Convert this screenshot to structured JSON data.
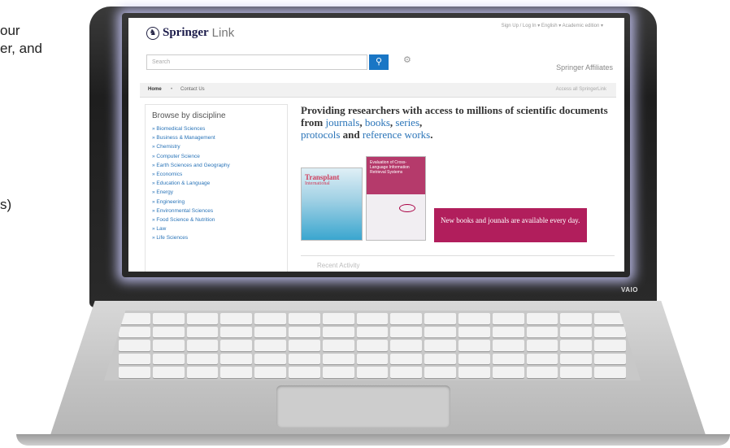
{
  "slide": {
    "lines": [
      "our",
      "er, and",
      "s)"
    ]
  },
  "device": {
    "brand": "VAIO"
  },
  "site": {
    "logo_primary": "Springer",
    "logo_secondary": "Link",
    "logo_icon": "springer-horse-icon",
    "top_nav": "Sign Up / Log In  ▾  English ▾  Academic edition ▾",
    "search_placeholder": "Search",
    "search_button_icon": "search-icon",
    "settings_icon": "gear-icon",
    "affiliates": "Springer Affiliates",
    "breadcrumb": {
      "home": "Home",
      "separator": "•",
      "contact": "Contact Us"
    },
    "access_text": "Access all SpringerLink",
    "browse": {
      "title": "Browse by discipline",
      "items": [
        "» Biomedical Sciences",
        "» Business & Management",
        "» Chemistry",
        "» Computer Science",
        "» Earth Sciences and Geography",
        "» Economics",
        "» Education & Language",
        "» Energy",
        "» Engineering",
        "» Environmental Sciences",
        "» Food Science & Nutrition",
        "» Law",
        "» Life Sciences"
      ]
    },
    "hero": {
      "part1": "Providing researchers with access to millions of scientific documents from ",
      "link_journals": "journals",
      "comma1": ", ",
      "link_books": "books",
      "comma2": ", ",
      "link_series": "series",
      "comma3": ",",
      "link_protocols": "protocols",
      "and": " and ",
      "link_reference": "reference works",
      "period": "."
    },
    "book1": {
      "title": "Transplant",
      "subtitle": "International"
    },
    "book2": {
      "title": "Evaluation of Cross-Language Information Retrieval Systems"
    },
    "promo": "New books and jounals are available every day.",
    "panel_label": "Recent Activity"
  },
  "colors": {
    "accent_blue": "#1976c5",
    "link_blue": "#2a74b8",
    "promo_magenta": "#b11e5c",
    "logo_navy": "#1b1b4a"
  }
}
